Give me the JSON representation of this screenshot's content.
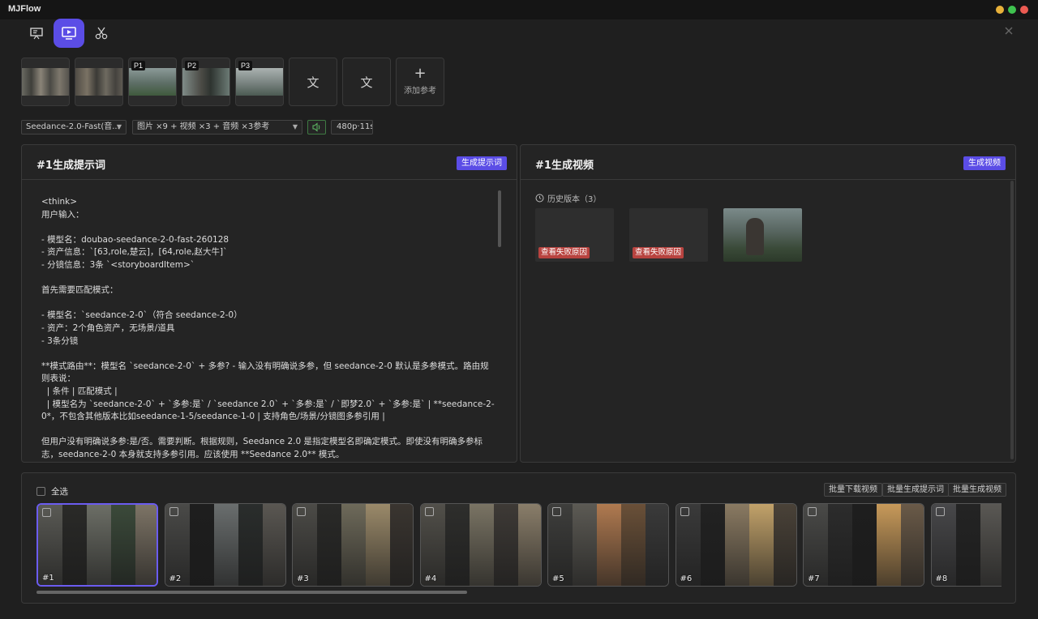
{
  "app": {
    "title": "MJFlow"
  },
  "window_controls": [
    "minimize",
    "maximize",
    "close"
  ],
  "toolbar": {
    "tabs": [
      {
        "icon": "presentation-icon",
        "active": false
      },
      {
        "icon": "video-play-icon",
        "active": true
      },
      {
        "icon": "scissors-icon",
        "active": false
      }
    ]
  },
  "references": {
    "items": [
      {
        "tag": "",
        "type": "image"
      },
      {
        "tag": "",
        "type": "image"
      },
      {
        "tag": "P1",
        "type": "image"
      },
      {
        "tag": "P2",
        "type": "image"
      },
      {
        "tag": "P3",
        "type": "image"
      },
      {
        "tag": "",
        "type": "text",
        "text": "文"
      },
      {
        "tag": "",
        "type": "text",
        "text": "文"
      }
    ],
    "add_label": "添加参考"
  },
  "settings": {
    "model": "Seedance-2.0-Fast(音...",
    "assets": "图片 ×9 + 视频 ×3 + 音频 ×3参考",
    "resolution": "480p·11s"
  },
  "prompt_panel": {
    "title": "#1生成提示词",
    "button": "生成提示词",
    "body": "<think>\n用户输入：\n\n- 模型名：doubao-seedance-2-0-fast-260128\n- 资产信息：`[63,role,楚云]，[64,role,赵大牛]`\n- 分镜信息：3条 `<storyboardItem>`\n\n首先需要匹配模式：\n\n- 模型名：`seedance-2-0`（符合 seedance-2-0）\n- 资产：2个角色资产，无场景/道具\n- 3条分镜\n\n**模式路由**：模型名 `seedance-2-0` + 多参? - 输入没有明确说多参，但 seedance-2-0 默认是多参模式。路由规则表说：\n  | 条件 | 匹配模式 |\n  | 模型名为 `seedance-2-0` + `多参:是` / `seedance 2.0` + `多参:是` / `即梦2.0` + `多参:是` | **seedance-2-0*，不包含其他版本比如seedance-1-5/seedance-1-0 | 支持角色/场景/分镜图多参引用 |\n\n但用户没有明确说多参:是/否。需要判断。根据规则，Seedance 2.0 是指定模型名即确定模式。即使没有明确多参标志，seedance-2-0 本身就支持多参引用。应该使用 **Seedance 2.0** 模式。"
  },
  "video_panel": {
    "title": "#1生成视频",
    "button": "生成视频",
    "history_label": "历史版本（3）",
    "versions": [
      {
        "status": "failed",
        "tag": "查看失败原因"
      },
      {
        "status": "failed",
        "tag": "查看失败原因"
      },
      {
        "status": "success",
        "tag": ""
      }
    ]
  },
  "storyboard": {
    "select_all": "全选",
    "buttons": [
      "批量下载视频",
      "批量生成提示词",
      "批量生成视频"
    ],
    "items": [
      {
        "num": "#1",
        "selected": true
      },
      {
        "num": "#2",
        "selected": false
      },
      {
        "num": "#3",
        "selected": false
      },
      {
        "num": "#4",
        "selected": false
      },
      {
        "num": "#5",
        "selected": false
      },
      {
        "num": "#6",
        "selected": false
      },
      {
        "num": "#7",
        "selected": false
      },
      {
        "num": "#8",
        "selected": false
      }
    ]
  },
  "colors": {
    "accent": "#5b4de6",
    "fail": "#b8433f",
    "background": "#1f1f1f",
    "panel": "#242424"
  }
}
